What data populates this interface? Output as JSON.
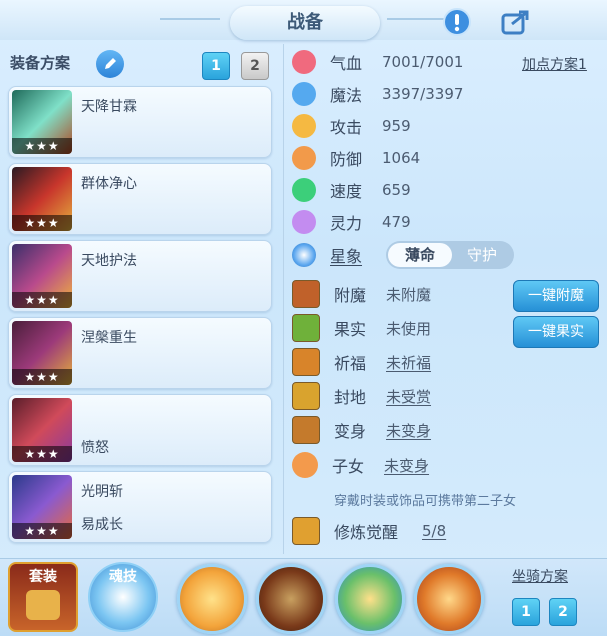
{
  "title": "战备",
  "header_icons": {
    "info": "exclamation-icon",
    "share": "share-icon"
  },
  "equip_plan": {
    "label": "装备方案",
    "pages": [
      "1",
      "2"
    ],
    "active_page": "1"
  },
  "slots": [
    {
      "name": "天降甘霖",
      "subname": "",
      "stars": "★★★"
    },
    {
      "name": "群体净心",
      "subname": "",
      "stars": "★★★"
    },
    {
      "name": "天地护法",
      "subname": "",
      "stars": "★★★"
    },
    {
      "name": "涅槃重生",
      "subname": "",
      "stars": "★★★"
    },
    {
      "name": "",
      "subname": "愤怒",
      "stars": "★★★"
    },
    {
      "name": "光明斩",
      "subname": "易成长",
      "stars": "★★★"
    }
  ],
  "stats": [
    {
      "label": "气血",
      "value": "7001/7001",
      "color": "#f06a7e"
    },
    {
      "label": "魔法",
      "value": "3397/3397",
      "color": "#55a9ef"
    },
    {
      "label": "攻击",
      "value": "959",
      "color": "#f5b942"
    },
    {
      "label": "防御",
      "value": "1064",
      "color": "#f29a4a"
    },
    {
      "label": "速度",
      "value": "659",
      "color": "#3ccf7a"
    },
    {
      "label": "灵力",
      "value": "479",
      "color": "#c38cf0"
    }
  ],
  "add_point_plan": "加点方案1",
  "star_sign": {
    "label": "星象",
    "options": [
      "薄命",
      "守护"
    ],
    "active": "薄命"
  },
  "attributes": [
    {
      "label": "附魔",
      "value": "未附魔",
      "underline": false,
      "color": "#c0612a"
    },
    {
      "label": "果实",
      "value": "未使用",
      "underline": false,
      "color": "#6fb13a"
    },
    {
      "label": "祈福",
      "value": "未祈福",
      "underline": true,
      "color": "#d8842a"
    },
    {
      "label": "封地",
      "value": "未受赏",
      "underline": true,
      "color": "#d9a32e"
    },
    {
      "label": "变身",
      "value": "未变身",
      "underline": true,
      "color": "#c47a2c"
    },
    {
      "label": "子女",
      "value": "未变身",
      "underline": true,
      "color": "#f39a4c"
    }
  ],
  "one_click": {
    "enchant": "一键附魔",
    "fruit": "一键果实"
  },
  "child_note": "穿戴时装或饰品可携带第二子女",
  "cultivation": {
    "label": "修炼觉醒",
    "value": "5/8"
  },
  "bottom": {
    "suit": "套装",
    "soul": "魂技",
    "mount_plan": "坐骑方案",
    "mount_pages": [
      "1",
      "2"
    ]
  }
}
